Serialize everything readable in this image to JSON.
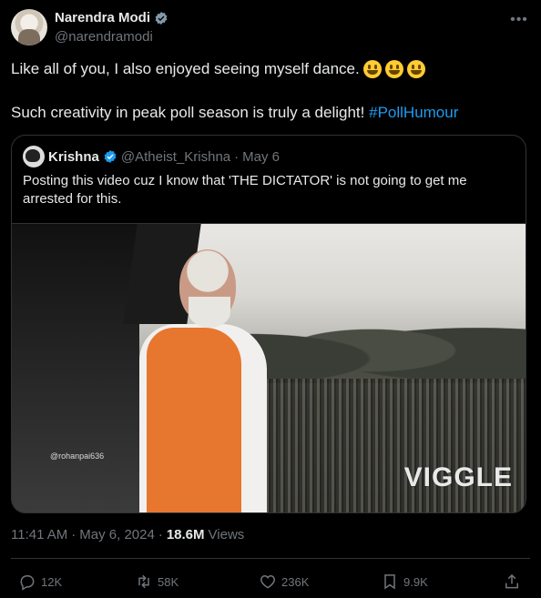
{
  "author": {
    "name": "Narendra Modi",
    "handle": "@narendramodi",
    "verified_badge": "grey-verified-badge"
  },
  "post": {
    "line1": "Like all of you, I also enjoyed seeing myself dance.",
    "emojis": [
      "grinning-face",
      "grinning-face",
      "grinning-face"
    ],
    "line2_text": "Such creativity in peak poll season is truly a delight!",
    "hashtag": "#PollHumour"
  },
  "quote": {
    "name": "Krishna",
    "handle": "@Atheist_Krishna",
    "separator": "·",
    "date": "May 6",
    "text": "Posting this video cuz I know that 'THE DICTATOR' is not going to get me arrested for this.",
    "video": {
      "watermark_small": "@rohanpai636",
      "watermark_big": "VIGGLE"
    }
  },
  "meta": {
    "time": "11:41 AM",
    "sep1": "·",
    "date": "May 6, 2024",
    "sep2": "·",
    "views_count": "18.6M",
    "views_label": "Views"
  },
  "actions": {
    "replies": "12K",
    "reposts": "58K",
    "likes": "236K",
    "bookmarks": "9.9K"
  },
  "colors": {
    "background": "#000000",
    "text": "#e7e9ea",
    "muted": "#71767b",
    "link": "#1d9bf0",
    "border": "#2f3336"
  }
}
